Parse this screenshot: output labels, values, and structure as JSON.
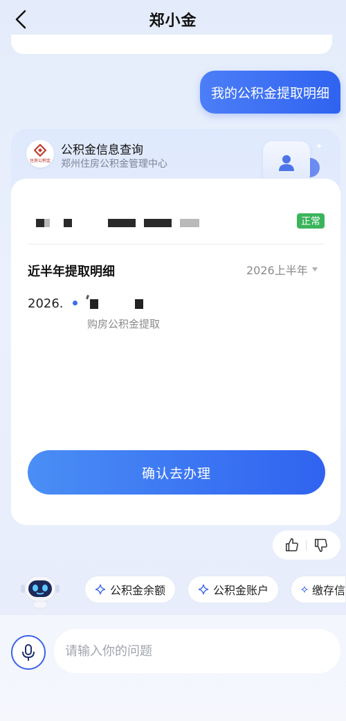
{
  "header": {
    "title": "郑小金"
  },
  "user_message": "我的公积金提取明细",
  "card": {
    "title": "公积金信息查询",
    "subtitle": "郑州住房公积金管理中心",
    "logo_text": "住房公积金",
    "status_badge": "正常",
    "section_title": "近半年提取明细",
    "period": "2026上半年",
    "detail_date": "2026.",
    "detail_type": "购房公积金提取",
    "confirm_button": "确认去办理"
  },
  "quick_chips": [
    "公积金余额",
    "公积金账户",
    "缴存信"
  ],
  "input": {
    "placeholder": "请输入你的问题"
  },
  "colors": {
    "accent": "#3063f0",
    "status_green": "#3bb55b"
  }
}
